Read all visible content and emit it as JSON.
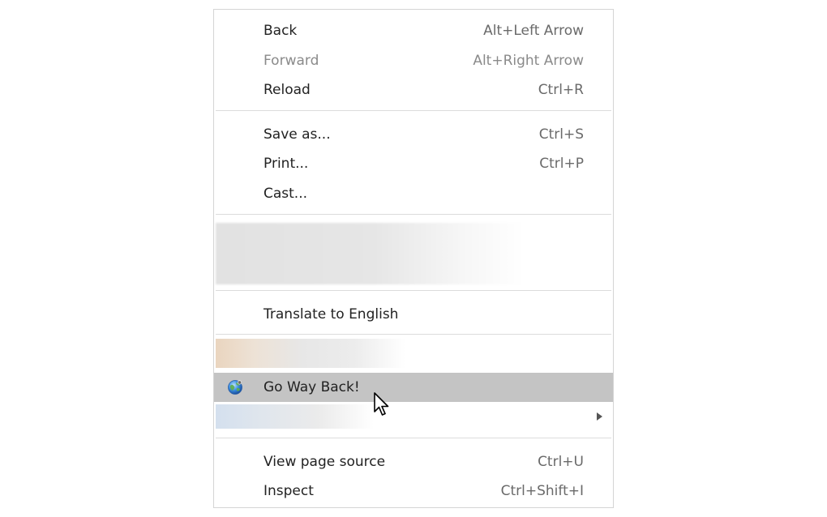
{
  "menu": {
    "navigation": [
      {
        "label": "Back",
        "shortcut": "Alt+Left Arrow",
        "enabled": true
      },
      {
        "label": "Forward",
        "shortcut": "Alt+Right Arrow",
        "enabled": false
      },
      {
        "label": "Reload",
        "shortcut": "Ctrl+R",
        "enabled": true
      }
    ],
    "page_actions": [
      {
        "label": "Save as...",
        "shortcut": "Ctrl+S"
      },
      {
        "label": "Print...",
        "shortcut": "Ctrl+P"
      },
      {
        "label": "Cast...",
        "shortcut": ""
      }
    ],
    "translate": {
      "label": "Translate to English"
    },
    "extension": {
      "label": "Go Way Back!",
      "icon": "globe-icon",
      "highlighted": true
    },
    "developer": [
      {
        "label": "View page source",
        "shortcut": "Ctrl+U"
      },
      {
        "label": "Inspect",
        "shortcut": "Ctrl+Shift+I"
      }
    ]
  },
  "colors": {
    "highlight": "#c4c4c4",
    "separator": "#dcdcdc",
    "text": "#222222",
    "disabled_text": "#8a8a8a"
  }
}
